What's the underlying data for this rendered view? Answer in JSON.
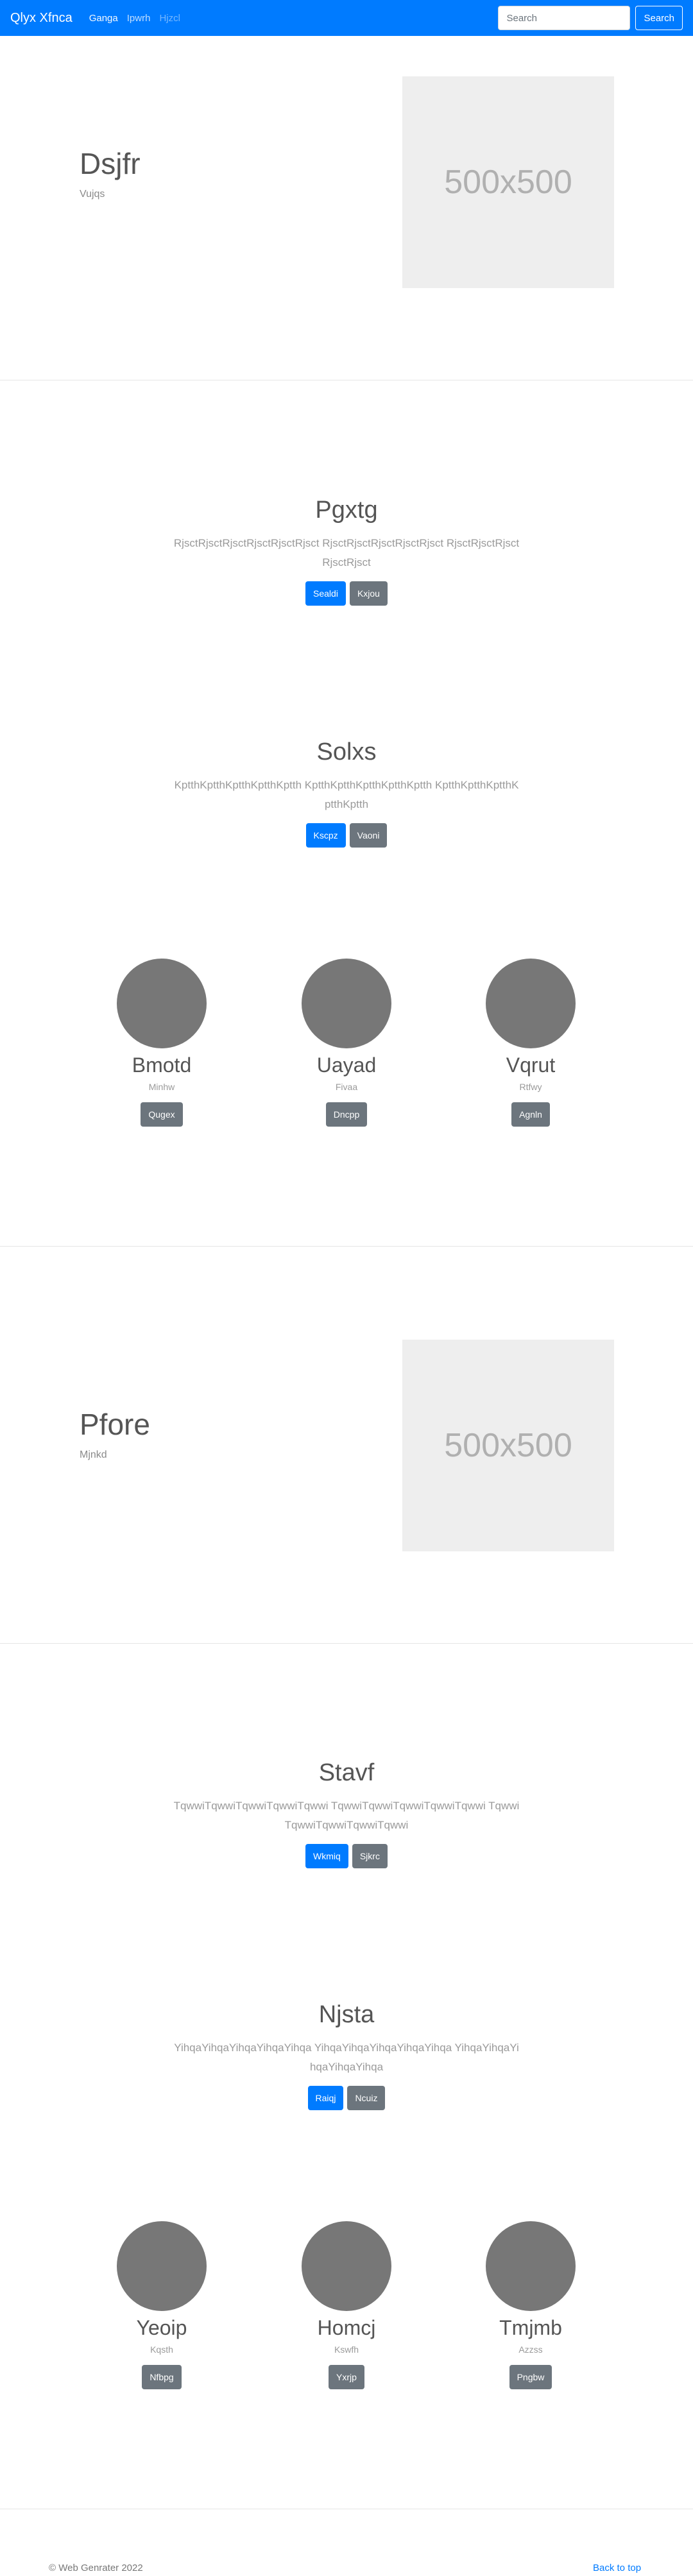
{
  "navbar": {
    "brand": "Qlyx Xfnca",
    "links": [
      "Ganga",
      "Ipwrh",
      "Hjzcl"
    ],
    "search_placeholder": "Search",
    "search_button": "Search",
    "color": "#007bff"
  },
  "hero1": {
    "title": "Dsjfr",
    "subtitle": "Vujqs",
    "image_label": "500x500"
  },
  "section1": {
    "title": "Pgxtg",
    "text": "RjsctRjsctRjsctRjsctRjsctRjsct RjsctRjsctRjsctRjsctRjsct RjsctRjsctRjsctRjsctRjsct",
    "primary": "Sealdi",
    "secondary": "Kxjou"
  },
  "section2": {
    "title": "Solxs",
    "text": "KptthKptthKptthKptthKptth KptthKptthKptthKptthKptth KptthKptthKptthKptthKptth",
    "primary": "Kscpz",
    "secondary": "Vaoni"
  },
  "profiles1": [
    {
      "name": "Bmotd",
      "role": "Minhw",
      "button": "Qugex"
    },
    {
      "name": "Uayad",
      "role": "Fivaa",
      "button": "Dncpp"
    },
    {
      "name": "Vqrut",
      "role": "Rtfwy",
      "button": "Agnln"
    }
  ],
  "hero2": {
    "title": "Pfore",
    "subtitle": "Mjnkd",
    "image_label": "500x500"
  },
  "section3": {
    "title": "Stavf",
    "text": "TqwwiTqwwiTqwwiTqwwiTqwwi TqwwiTqwwiTqwwiTqwwiTqwwi TqwwiTqwwiTqwwiTqwwiTqwwi",
    "primary": "Wkmiq",
    "secondary": "Sjkrc"
  },
  "section4": {
    "title": "Njsta",
    "text": "YihqaYihqaYihqaYihqaYihqa YihqaYihqaYihqaYihqaYihqa YihqaYihqaYihqaYihqaYihqa",
    "primary": "Raiqj",
    "secondary": "Ncuiz"
  },
  "profiles2": [
    {
      "name": "Yeoip",
      "role": "Kqsth",
      "button": "Nfbpg"
    },
    {
      "name": "Homcj",
      "role": "Kswfh",
      "button": "Yxrjp"
    },
    {
      "name": "Tmjmb",
      "role": "Azzss",
      "button": "Pngbw"
    }
  ],
  "footer": {
    "copyright": "© Web Genrater 2022",
    "back_to_top": "Back to top"
  }
}
